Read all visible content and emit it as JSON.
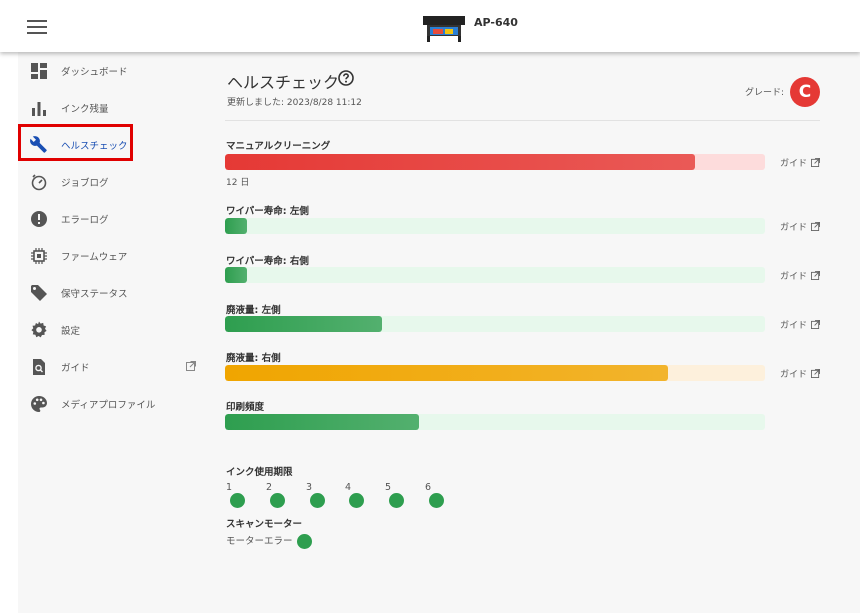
{
  "header": {
    "model": "AP-640"
  },
  "sidebar": {
    "items": [
      {
        "label": "ダッシュボード"
      },
      {
        "label": "インク残量"
      },
      {
        "label": "ヘルスチェック"
      },
      {
        "label": "ジョブログ"
      },
      {
        "label": "エラーログ"
      },
      {
        "label": "ファームウェア"
      },
      {
        "label": "保守ステータス"
      },
      {
        "label": "設定"
      },
      {
        "label": "ガイド"
      },
      {
        "label": "メディアプロファイル"
      }
    ]
  },
  "page": {
    "title": "ヘルスチェック",
    "updated": "更新しました: 2023/8/28 11:12",
    "grade_label": "グレード:",
    "grade_value": "C",
    "guide_label": "ガイド"
  },
  "colors": {
    "red": "#e53935",
    "red_bg": "#fddcdc",
    "green": "#2e9e4f",
    "green_bg": "#e7f8ec",
    "amber": "#f0a500",
    "amber_bg": "#fdf0dc"
  },
  "health": [
    {
      "label": "マニュアルクリーニング",
      "level": 0.87,
      "color": "red",
      "sub": "12 日",
      "guide": true
    },
    {
      "label": "ワイパー寿命: 左側",
      "level": 0.04,
      "color": "green",
      "guide": true
    },
    {
      "label": "ワイパー寿命: 右側",
      "level": 0.04,
      "color": "green",
      "guide": true
    },
    {
      "label": "廃液量: 左側",
      "level": 0.29,
      "color": "green",
      "guide": true
    },
    {
      "label": "廃液量: 右側",
      "level": 0.82,
      "color": "amber",
      "guide": true
    },
    {
      "label": "印刷頻度",
      "level": 0.36,
      "color": "green",
      "guide": false
    }
  ],
  "ink_expiry": {
    "label": "インク使用期限",
    "slots": [
      "1",
      "2",
      "3",
      "4",
      "5",
      "6"
    ]
  },
  "scan_motor": {
    "label": "スキャンモーター",
    "status": "モーターエラー"
  }
}
